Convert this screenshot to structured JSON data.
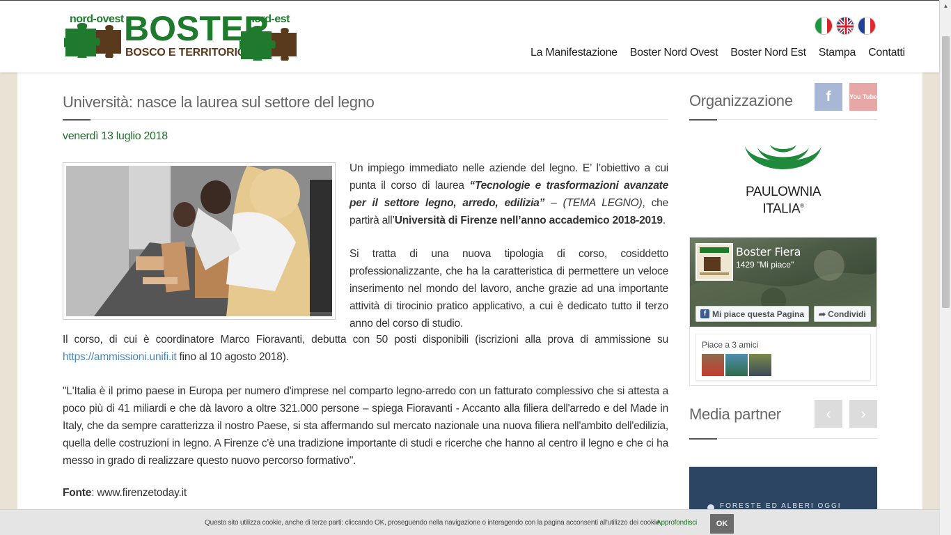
{
  "header": {
    "logo": {
      "tag_left": "nord-ovest",
      "brand": "BOSTER",
      "tag_right": "nord-est",
      "subtitle": "BOSCO E TERRITORIO"
    },
    "flags": [
      "italian-flag-icon",
      "uk-flag-icon",
      "french-flag-icon"
    ],
    "nav": [
      {
        "label": "La Manifestazione"
      },
      {
        "label": "Boster Nord Ovest"
      },
      {
        "label": "Boster Nord Est"
      },
      {
        "label": "Stampa"
      },
      {
        "label": "Contatti"
      }
    ]
  },
  "article": {
    "title": "Università: nasce la laurea sul settore del legno",
    "date": "venerdì 13 luglio 2018",
    "p1": {
      "a": "Un impiego immediato nelle aziende del legno. E’ l’obiettivo a cui punta il corso di laurea ",
      "b": "“Tecnologie e trasformazioni avanzate per il settore legno, arredo, edilizia”",
      "c": " – (TEMA LEGNO)",
      "d": ", che partirà all’",
      "e": "Università di Firenze nell’anno accademico 2018-2019",
      "f": "."
    },
    "p2": "Si tratta di una nuova tipologia di corso, cosiddetto professionalizzante, che ha la caratteristica di permettere un veloce inserimento nel mondo del lavoro, anche grazie ad una importante attività di tirocinio pratico applicativo, a cui è dedicato tutto il terzo anno del corso di studio.",
    "p3": {
      "a": "Il corso, di cui è coordinatore Marco Fioravanti, debutta con 50 posti disponibili (iscrizioni alla prova di ammissione su ",
      "link": "https://ammissioni.unifi.it",
      "b": " fino al 10 agosto 2018)."
    },
    "p4": "\"L'Italia è il primo paese in Europa per numero d'imprese nel comparto legno-arredo con un fatturato complessivo che si attesta a poco più di 41 miliardi e che dà lavoro a oltre 321.000 persone – spiega Fioravanti - Accanto alla filiera dell'arredo e del Made in Italy, che da sempre caratterizza il nostro Paese, si sta affermando sul mercato nazionale una nuova filiera nell'ambito dell'edilizia, quella delle costruzioni in legno. A Firenze c'è una tradizione importante di studi e ricerche che hanno al centro il legno e che ci ha messo in grado di realizzare questo nuovo percorso formativo\".",
    "fonte_label": "Fonte",
    "fonte_value": ": www.firenzetoday.it"
  },
  "sidebar": {
    "org_title": "Organizzazione",
    "social": {
      "facebook": "f",
      "youtube": "You Tube"
    },
    "sponsor": {
      "line1": "PAULOWNIA",
      "line2": "ITALIA",
      "mark": "®"
    },
    "fb": {
      "title": "Boster Fiera",
      "likes": "1429 \"Mi piace\"",
      "like_button": "Mi piace questa Pagina",
      "share_button": "Condividi",
      "friends": "Piace a 3 amici"
    },
    "media_title": "Media partner",
    "media_banner_text": "FORESTE ED ALBERI OGGI"
  },
  "cookie": {
    "message": "Questo sito utilizza cookie, anche di terze parti: cliccando OK, proseguendo nella navigazione o interagendo con la pagina acconsenti all'utilizzo dei cookie.",
    "more": "Approfondisci",
    "ok": "OK"
  },
  "colors": {
    "brand_green": "#1f7a2e",
    "brand_brown": "#5a3a1c",
    "link_blue": "#4a86b8",
    "facebook": "#a8b7d6",
    "youtube": "#e8a7a7"
  }
}
